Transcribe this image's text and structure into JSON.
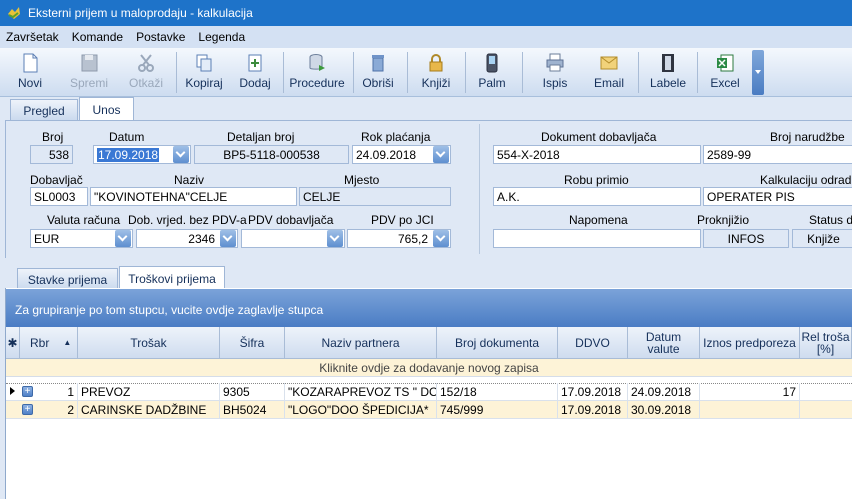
{
  "window": {
    "title": "Eksterni prijem u maloprodaju - kalkulacija"
  },
  "menu": [
    "Završetak",
    "Komande",
    "Postavke",
    "Legenda"
  ],
  "toolbar": {
    "novi": "Novi",
    "spremi": "Spremi",
    "otkazi": "Otkaži",
    "kopiraj": "Kopiraj",
    "dodaj": "Dodaj",
    "procedure": "Procedure",
    "obrisi": "Obriši",
    "knjizi": "Knjiži",
    "palm": "Palm",
    "ispis": "Ispis",
    "email": "Email",
    "labele": "Labele",
    "excel": "Excel"
  },
  "tabs": {
    "pregled": "Pregled",
    "unos": "Unos"
  },
  "form": {
    "broj_label": "Broj",
    "broj": "538",
    "datum_label": "Datum",
    "datum": "17.09.2018",
    "detaljan_broj_label": "Detaljan broj",
    "detaljan_broj": "BP5-5118-000538",
    "rok_placanja_label": "Rok plaćanja",
    "rok_placanja": "24.09.2018",
    "dobavljac_label": "Dobavljač",
    "dobavljac": "SL0003",
    "naziv_label": "Naziv",
    "naziv": "\"KOVINOTEHNA\"CELJE",
    "mjesto_label": "Mjesto",
    "mjesto": "CELJE",
    "valuta_label": "Valuta računa",
    "valuta": "EUR",
    "dob_vrijed_label": "Dob. vrjed. bez PDV-a",
    "dob_vrijed": "2346",
    "pdv_dob_label": "PDV dobavljača",
    "pdv_dob": "",
    "pdv_jci_label": "PDV po JCI",
    "pdv_jci": "765,2",
    "dokument_dob_label": "Dokument dobavljača",
    "dokument_dob": "554-X-2018",
    "broj_narudzbe_label": "Broj narudžbe",
    "broj_narudzbe": "2589-99",
    "robu_primio_label": "Robu primio",
    "robu_primio": "A.K.",
    "kalkulaciju_label": "Kalkulaciju odradi",
    "kalkulaciju": "OPERATER PIS",
    "napomena_label": "Napomena",
    "napomena": "",
    "proknjizio_label": "Proknjižio",
    "proknjizio": "INFOS",
    "status_label": "Status d",
    "status": "Knjiže"
  },
  "subtabs": {
    "stavke": "Stavke prijema",
    "troskovi": "Troškovi prijema"
  },
  "grid": {
    "group_hint": "Za grupiranje po tom stupcu, vucite ovdje zaglavlje stupca",
    "new_row": "Kliknite ovdje za dodavanje novog zapisa",
    "headers": {
      "star": "✱",
      "rbr": "Rbr",
      "trosak": "Trošak",
      "sifra": "Šifra",
      "naziv_partnera": "Naziv partnera",
      "broj_dokumenta": "Broj dokumenta",
      "ddvo": "DDVO",
      "datum_valute": "Datum\nvalute",
      "iznos": "Iznos predporeza",
      "rel": "Rel troša\n[%]"
    },
    "rows": [
      {
        "rbr": "1",
        "trosak": "PREVOZ",
        "sifra": "9305",
        "partner": "\"KOZARAPREVOZ TS \" DOO",
        "dokument": "152/18",
        "ddvo": "17.09.2018",
        "valuta": "24.09.2018",
        "iznos": "17"
      },
      {
        "rbr": "2",
        "trosak": "CARINSKE DADŽBINE",
        "sifra": "BH5024",
        "partner": "\"LOGO\"DOO ŠPEDICIJA*",
        "dokument": "745/999",
        "ddvo": "17.09.2018",
        "valuta": "30.09.2018",
        "iznos": ""
      }
    ]
  },
  "colors": {
    "titlebar": "#1e73c9",
    "group_bar": "#5a8acb",
    "new_row_bg": "#fdf3d7"
  }
}
